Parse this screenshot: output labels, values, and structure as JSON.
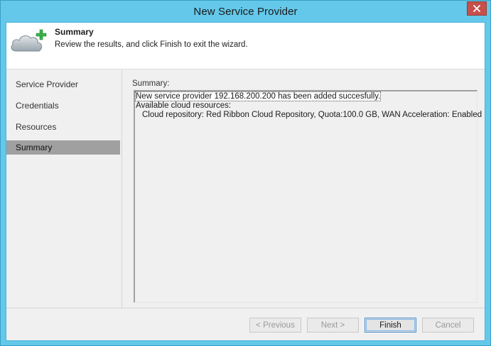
{
  "window": {
    "title": "New Service Provider",
    "close_icon": "close-icon"
  },
  "header": {
    "title": "Summary",
    "description": "Review the results, and click Finish to exit the wizard.",
    "icon": "cloud-add-icon",
    "icon_colors": {
      "cloud": "#a9b3bb",
      "plus": "#3cb44a"
    }
  },
  "steps": [
    {
      "label": "Service Provider",
      "active": false
    },
    {
      "label": "Credentials",
      "active": false
    },
    {
      "label": "Resources",
      "active": false
    },
    {
      "label": "Summary",
      "active": true
    }
  ],
  "summary": {
    "label": "Summary:",
    "lines": [
      "New service provider 192.168.200.200 has been added succesfully.",
      "Available cloud resources:",
      "Cloud repository: Red Ribbon Cloud Repository, Quota:100.0 GB, WAN Acceleration: Enabled"
    ]
  },
  "buttons": {
    "previous": {
      "label": "< Previous",
      "enabled": false
    },
    "next": {
      "label": "Next >",
      "enabled": false
    },
    "finish": {
      "label": "Finish",
      "enabled": true
    },
    "cancel": {
      "label": "Cancel",
      "enabled": false
    }
  },
  "colors": {
    "title_bar": "#64c8ea",
    "close_button": "#c7504a",
    "active_step": "#a0a0a0",
    "primary_button_border": "#4d8fc6"
  }
}
